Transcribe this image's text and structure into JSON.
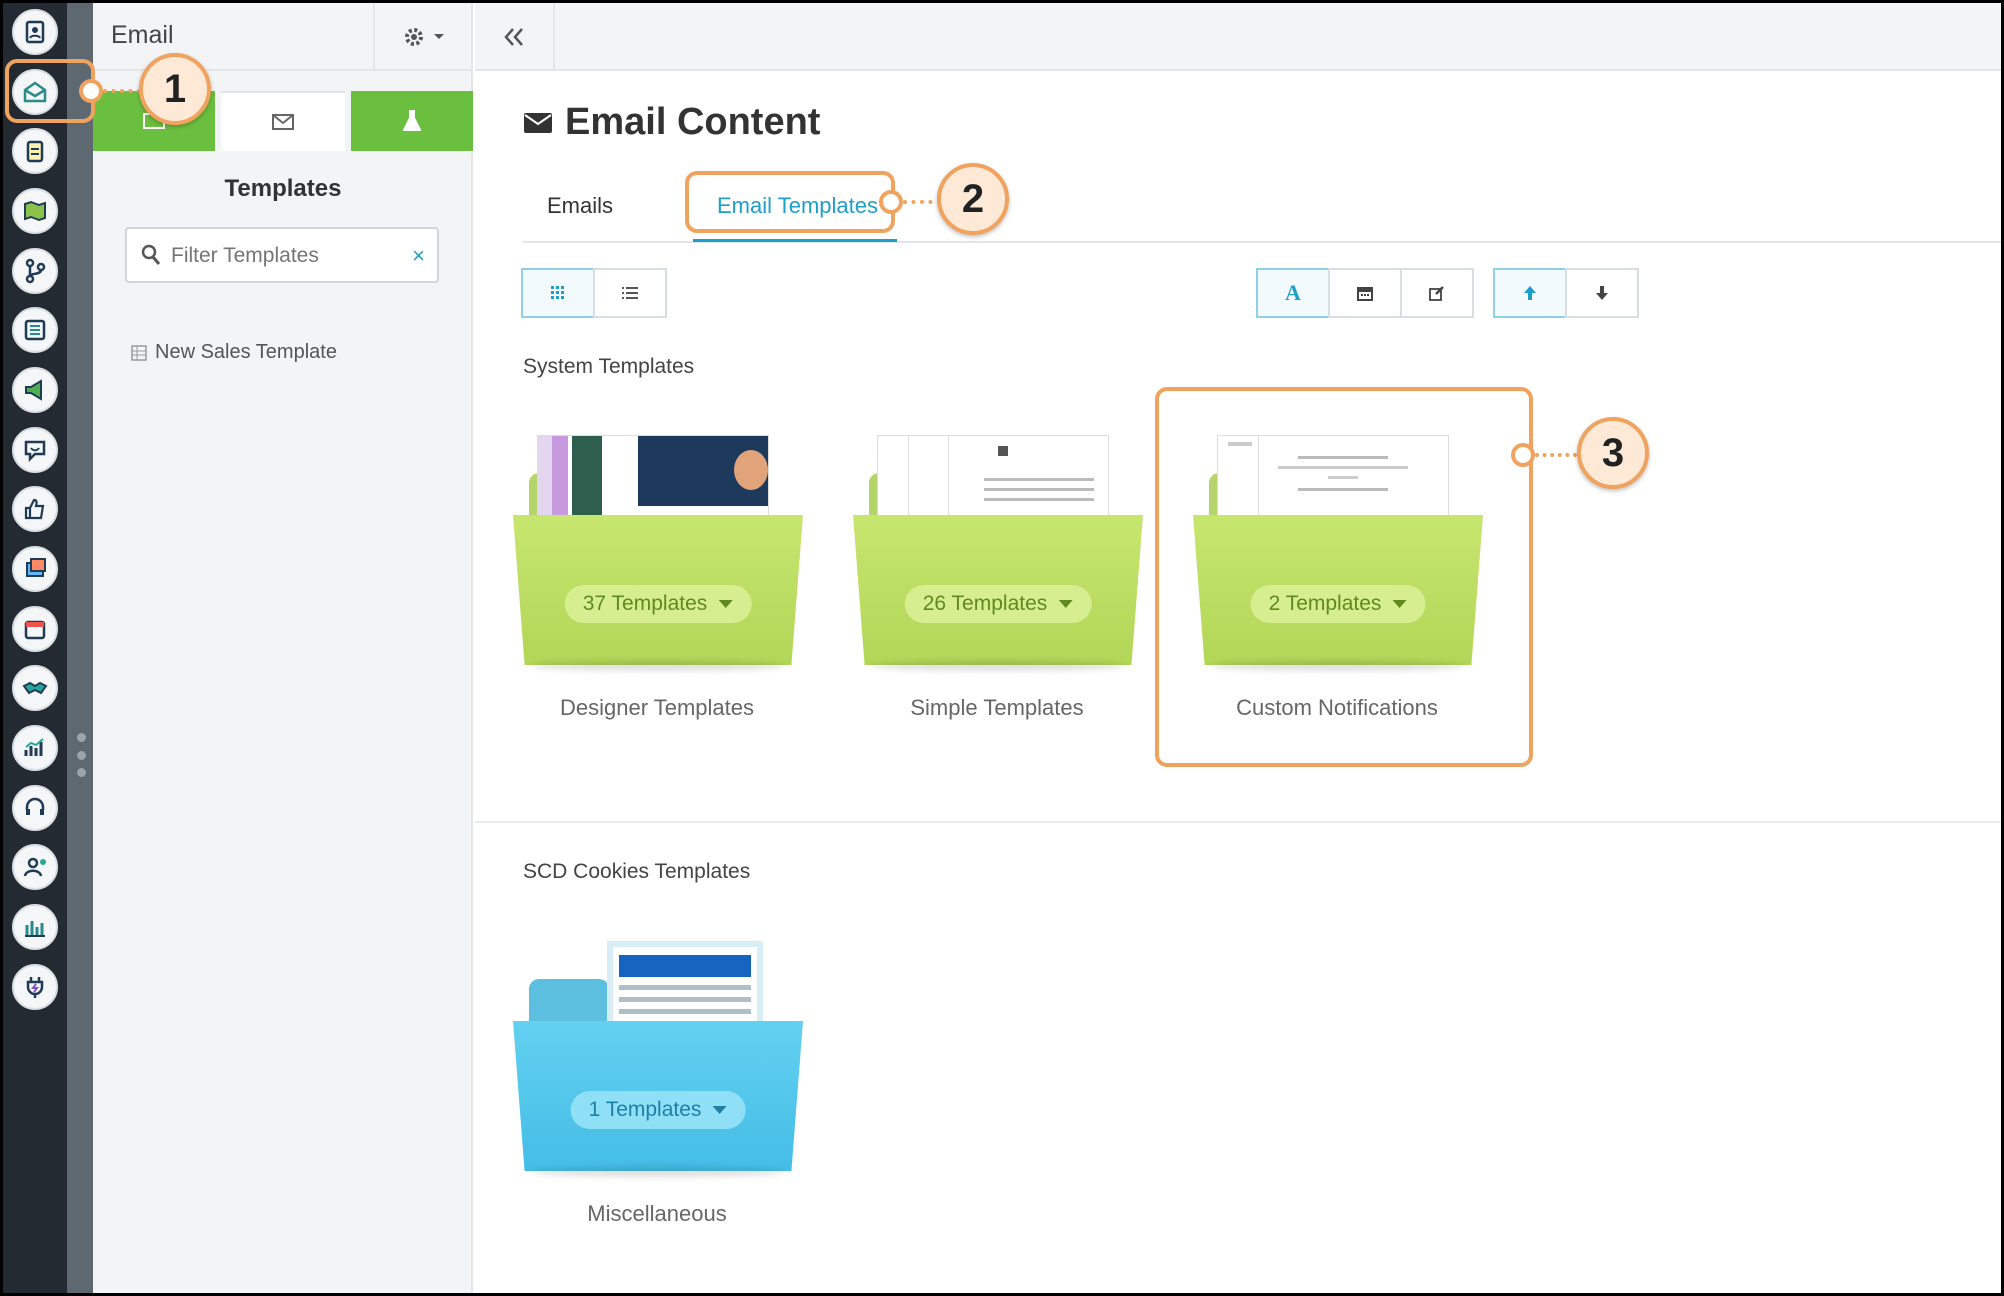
{
  "sidebar": {
    "title": "Email",
    "section_title": "Templates",
    "filter_placeholder": "Filter Templates",
    "clear_symbol": "×",
    "tree_items": [
      "New Sales Template"
    ]
  },
  "main": {
    "page_title": "Email Content",
    "tabs": [
      {
        "label": "Emails",
        "active": false
      },
      {
        "label": "Email Templates",
        "active": true
      }
    ],
    "sections": [
      {
        "title": "System Templates",
        "folders": [
          {
            "name": "Designer Templates",
            "count_label": "37 Templates",
            "color": "#b6d95c"
          },
          {
            "name": "Simple Templates",
            "count_label": "26 Templates",
            "color": "#b6d95c"
          },
          {
            "name": "Custom Notifications",
            "count_label": "2 Templates",
            "color": "#b6d95c"
          }
        ]
      },
      {
        "title": "SCD Cookies Templates",
        "folders": [
          {
            "name": "Miscellaneous",
            "count_label": "1 Templates",
            "color": "#4cc6ec"
          }
        ]
      }
    ],
    "sort_letter": "A"
  },
  "annotations": [
    "1",
    "2",
    "3"
  ],
  "colors": {
    "accent": "#1e9fc9",
    "callout": "#f0a35e",
    "green_tab": "#6bbf3f"
  }
}
